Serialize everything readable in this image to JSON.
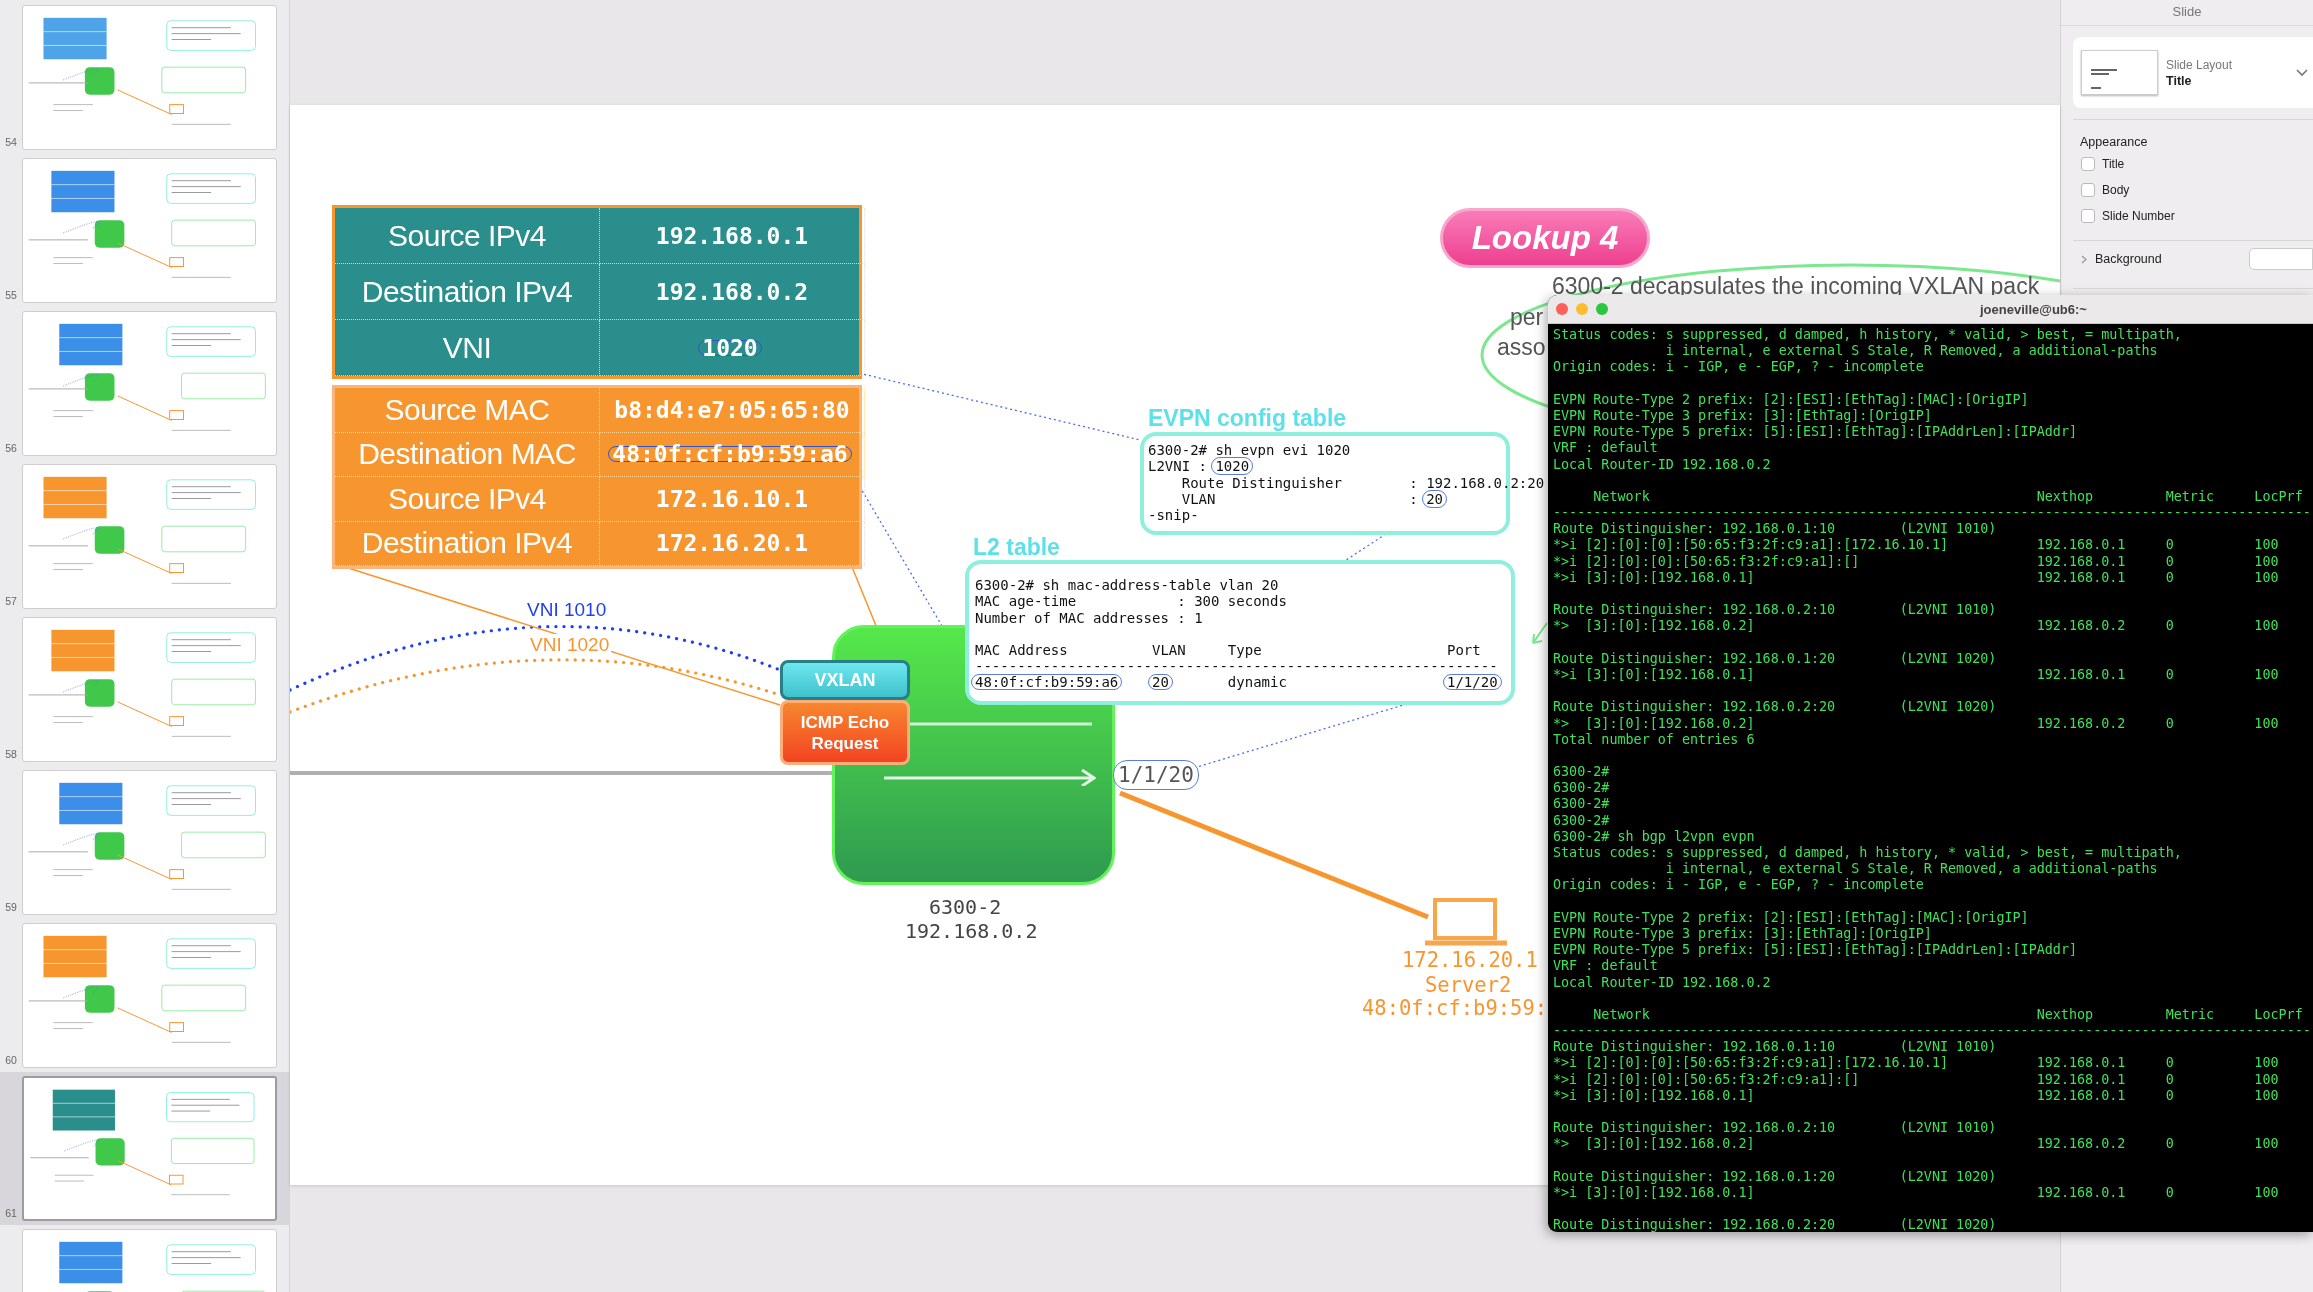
{
  "slide_navigator": {
    "slides": [
      {
        "number": "54",
        "selected": false,
        "color": "#4fa3e8"
      },
      {
        "number": "55",
        "selected": false,
        "color": "#3b8fe8"
      },
      {
        "number": "56",
        "selected": false,
        "color": "#3b8fe8"
      },
      {
        "number": "57",
        "selected": false,
        "color": "#f7962f"
      },
      {
        "number": "58",
        "selected": false,
        "color": "#f7962f"
      },
      {
        "number": "59",
        "selected": false,
        "color": "#3b8fe8"
      },
      {
        "number": "60",
        "selected": false,
        "color": "#f7962f"
      },
      {
        "number": "61",
        "selected": true,
        "color": "#2a8f8c"
      },
      {
        "selected": false,
        "color": "#3b8fe8"
      }
    ]
  },
  "slide": {
    "outer_header": {
      "rows": [
        {
          "label": "Source IPv4",
          "value": "192.168.0.1",
          "circled": false
        },
        {
          "label": "Destination IPv4",
          "value": "192.168.0.2",
          "circled": false
        },
        {
          "label": "VNI",
          "value": "1020",
          "circled": true
        }
      ]
    },
    "inner_header": {
      "rows": [
        {
          "label": "Source MAC",
          "value": "b8:d4:e7:05:65:80",
          "circled": false
        },
        {
          "label": "Destination MAC",
          "value": "48:0f:cf:b9:59:a6",
          "circled": true
        },
        {
          "label": "Source IPv4",
          "value": "172.16.10.1",
          "circled": false
        },
        {
          "label": "Destination IPv4",
          "value": "172.16.20.1",
          "circled": false
        }
      ]
    },
    "tunnels": [
      {
        "label": "VNI 1010",
        "color": "#1f3ff0"
      },
      {
        "label": "VNI 1020",
        "color": "#f7962f"
      }
    ],
    "callout": {
      "title": "Lookup 4",
      "lines": [
        "6300-2 decapsulates the incoming VXLAN pack",
        "per",
        "asso"
      ]
    },
    "evpn_table": {
      "title": "EVPN config table",
      "lines": [
        {
          "text": "6300-2# sh evpn evi 1020"
        },
        {
          "text": "L2VNI : ",
          "circled": "1020"
        },
        {
          "text": "    Route Distinguisher        : 192.168.0.2:20"
        },
        {
          "text": "    VLAN                       : ",
          "circled": "20"
        },
        {
          "text": "-snip-"
        }
      ]
    },
    "l2_table": {
      "title": "L2 table",
      "lines": [
        "6300-2# sh mac-address-table vlan 20",
        "MAC age-time            : 300 seconds",
        "Number of MAC addresses : 1"
      ],
      "columns": [
        "MAC Address",
        "VLAN",
        "Type",
        "Port"
      ],
      "rule": "--------------------------------------------------------------",
      "rows": [
        {
          "cells": [
            {
              "text": "48:0f:cf:b9:59:a6",
              "circled": true
            },
            {
              "text": "20",
              "circled": true
            },
            {
              "text": "dynamic",
              "circled": false
            },
            {
              "text": "1/1/20",
              "circled": true
            }
          ]
        }
      ]
    },
    "switch": {
      "badges": [
        {
          "kind": "tunnel",
          "label": "VXLAN"
        },
        {
          "kind": "payload",
          "label": "ICMP Echo Request"
        }
      ],
      "port": "1/1/20",
      "name": "6300-2",
      "address": "192.168.0.2"
    },
    "server": {
      "address": "172.16.20.1",
      "name": "Server2",
      "mac": "48:0f:cf:b9:59:"
    }
  },
  "inspector": {
    "title": "Slide",
    "layout": {
      "label": "Slide Layout",
      "value": "Title"
    },
    "appearance": {
      "title": "Appearance",
      "options": [
        {
          "label": "Title",
          "checked": false
        },
        {
          "label": "Body",
          "checked": false
        },
        {
          "label": "Slide Number",
          "checked": false
        }
      ]
    },
    "background": {
      "label": "Background"
    }
  },
  "terminal": {
    "title": "joeneville@ub6:~",
    "blocks": [
      [
        {
          "kind": "text",
          "text": "Status codes: s suppressed, d damped, h history, * valid, > best, = multipath,"
        },
        {
          "kind": "text",
          "text": "              i internal, e external S Stale, R Removed, a additional-paths"
        },
        {
          "kind": "text",
          "text": "Origin codes: i - IGP, e - EGP, ? - incomplete"
        }
      ],
      [
        {
          "kind": "text",
          "text": "EVPN Route-Type 2 prefix: [2]:[ESI]:[EthTag]:[MAC]:[OrigIP]"
        },
        {
          "kind": "text",
          "text": "EVPN Route-Type 3 prefix: [3]:[EthTag]:[OrigIP]"
        },
        {
          "kind": "text",
          "text": "EVPN Route-Type 5 prefix: [5]:[ESI]:[EthTag]:[IPAddrLen]:[IPAddr]"
        },
        {
          "kind": "text",
          "text": "VRF : default"
        },
        {
          "kind": "text",
          "text": "Local Router-ID 192.168.0.2"
        }
      ],
      [
        {
          "kind": "header",
          "network": "Network",
          "nexthop": "Nexthop",
          "metric": "Metric",
          "locprf": "LocPrf"
        },
        {
          "kind": "rule",
          "text": "----------------------------------------------------------------------------------------------"
        },
        {
          "kind": "rd",
          "text": "Route Distinguisher: 192.168.0.1:10",
          "vni": "(L2VNI 1010)"
        },
        {
          "kind": "route",
          "network": "*>i [2]:[0]:[0]:[50:65:f3:2f:c9:a1]:[172.16.10.1]",
          "nexthop": "192.168.0.1",
          "metric": "0",
          "locprf": "100"
        },
        {
          "kind": "route",
          "network": "*>i [2]:[0]:[0]:[50:65:f3:2f:c9:a1]:[]",
          "nexthop": "192.168.0.1",
          "metric": "0",
          "locprf": "100"
        },
        {
          "kind": "route",
          "network": "*>i [3]:[0]:[192.168.0.1]",
          "nexthop": "192.168.0.1",
          "metric": "0",
          "locprf": "100"
        }
      ],
      [
        {
          "kind": "rd",
          "text": "Route Distinguisher: 192.168.0.2:10",
          "vni": "(L2VNI 1010)"
        },
        {
          "kind": "route",
          "network": "*>  [3]:[0]:[192.168.0.2]",
          "nexthop": "192.168.0.2",
          "metric": "0",
          "locprf": "100"
        }
      ],
      [
        {
          "kind": "rd",
          "text": "Route Distinguisher: 192.168.0.1:20",
          "vni": "(L2VNI 1020)"
        },
        {
          "kind": "route",
          "network": "*>i [3]:[0]:[192.168.0.1]",
          "nexthop": "192.168.0.1",
          "metric": "0",
          "locprf": "100"
        }
      ],
      [
        {
          "kind": "rd",
          "text": "Route Distinguisher: 192.168.0.2:20",
          "vni": "(L2VNI 1020)"
        },
        {
          "kind": "route",
          "network": "*>  [3]:[0]:[192.168.0.2]",
          "nexthop": "192.168.0.2",
          "metric": "0",
          "locprf": "100"
        },
        {
          "kind": "text",
          "text": "Total number of entries 6"
        }
      ],
      [
        {
          "kind": "text",
          "text": "6300-2#"
        },
        {
          "kind": "text",
          "text": "6300-2#"
        },
        {
          "kind": "text",
          "text": "6300-2#"
        },
        {
          "kind": "text",
          "text": "6300-2#"
        },
        {
          "kind": "text",
          "text": "6300-2# sh bgp l2vpn evpn"
        },
        {
          "kind": "text",
          "text": "Status codes: s suppressed, d damped, h history, * valid, > best, = multipath,"
        },
        {
          "kind": "text",
          "text": "              i internal, e external S Stale, R Removed, a additional-paths"
        },
        {
          "kind": "text",
          "text": "Origin codes: i - IGP, e - EGP, ? - incomplete"
        }
      ],
      [
        {
          "kind": "text",
          "text": "EVPN Route-Type 2 prefix: [2]:[ESI]:[EthTag]:[MAC]:[OrigIP]"
        },
        {
          "kind": "text",
          "text": "EVPN Route-Type 3 prefix: [3]:[EthTag]:[OrigIP]"
        },
        {
          "kind": "text",
          "text": "EVPN Route-Type 5 prefix: [5]:[ESI]:[EthTag]:[IPAddrLen]:[IPAddr]"
        },
        {
          "kind": "text",
          "text": "VRF : default"
        },
        {
          "kind": "text",
          "text": "Local Router-ID 192.168.0.2"
        }
      ],
      [
        {
          "kind": "header",
          "network": "Network",
          "nexthop": "Nexthop",
          "metric": "Metric",
          "locprf": "LocPrf"
        },
        {
          "kind": "rule",
          "text": "----------------------------------------------------------------------------------------------"
        },
        {
          "kind": "rd",
          "text": "Route Distinguisher: 192.168.0.1:10",
          "vni": "(L2VNI 1010)"
        },
        {
          "kind": "route",
          "network": "*>i [2]:[0]:[0]:[50:65:f3:2f:c9:a1]:[172.16.10.1]",
          "nexthop": "192.168.0.1",
          "metric": "0",
          "locprf": "100"
        },
        {
          "kind": "route",
          "network": "*>i [2]:[0]:[0]:[50:65:f3:2f:c9:a1]:[]",
          "nexthop": "192.168.0.1",
          "metric": "0",
          "locprf": "100"
        },
        {
          "kind": "route",
          "network": "*>i [3]:[0]:[192.168.0.1]",
          "nexthop": "192.168.0.1",
          "metric": "0",
          "locprf": "100"
        }
      ],
      [
        {
          "kind": "rd",
          "text": "Route Distinguisher: 192.168.0.2:10",
          "vni": "(L2VNI 1010)"
        },
        {
          "kind": "route",
          "network": "*>  [3]:[0]:[192.168.0.2]",
          "nexthop": "192.168.0.2",
          "metric": "0",
          "locprf": "100"
        }
      ],
      [
        {
          "kind": "rd",
          "text": "Route Distinguisher: 192.168.0.1:20",
          "vni": "(L2VNI 1020)"
        },
        {
          "kind": "route",
          "network": "*>i [3]:[0]:[192.168.0.1]",
          "nexthop": "192.168.0.1",
          "metric": "0",
          "locprf": "100"
        }
      ],
      [
        {
          "kind": "rd",
          "text": "Route Distinguisher: 192.168.0.2:20",
          "vni": "(L2VNI 1020)"
        }
      ]
    ]
  }
}
